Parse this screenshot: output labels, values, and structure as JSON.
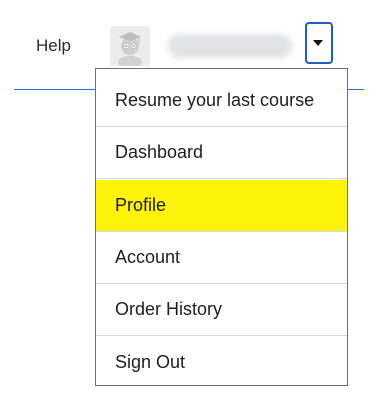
{
  "header": {
    "help_label": "Help",
    "username": "███ ██████",
    "rule_color": "#1f77d6",
    "toggle_border_color": "#1f5ec7",
    "avatar_icon": "user-avatar-icon",
    "toggle_icon": "caret-down-icon"
  },
  "menu": {
    "highlight_color": "#fff30c",
    "items": [
      {
        "label": "Resume your last course"
      },
      {
        "label": "Dashboard"
      },
      {
        "label": "Profile",
        "highlighted": true
      },
      {
        "label": "Account"
      },
      {
        "label": "Order History"
      },
      {
        "label": "Sign Out"
      }
    ]
  }
}
